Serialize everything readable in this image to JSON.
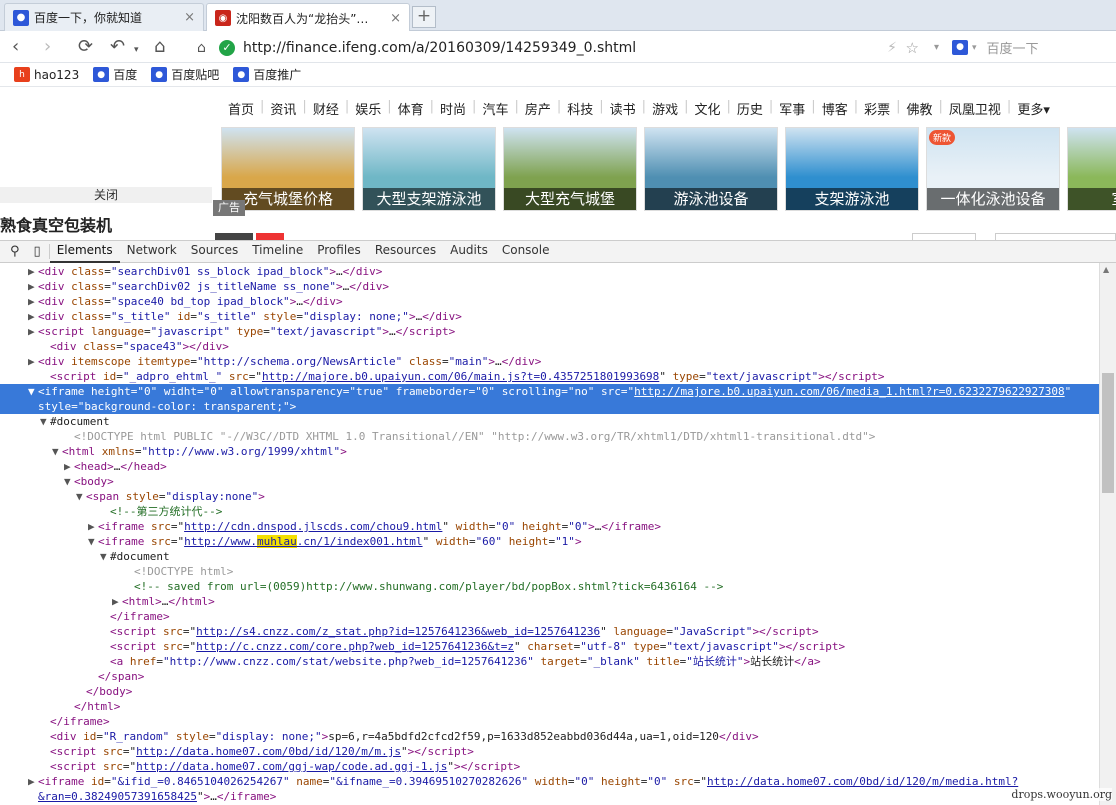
{
  "tabs": [
    {
      "title": "百度一下，你就知道",
      "close": "×",
      "color": "#2e58d8",
      "icon": "baidu-paw-icon"
    },
    {
      "title": "沈阳数百人为“龙抬头”…",
      "close": "×",
      "color": "#c9261b",
      "icon": "ifeng-icon"
    }
  ],
  "new_tab": "+",
  "address": {
    "url": "http://finance.ifeng.com/a/20160309/14259349_0.shtml"
  },
  "search": {
    "placeholder": "百度一下"
  },
  "bookmarks": [
    {
      "label": "hao123",
      "color": "#e8401c",
      "icon": "hao123-icon"
    },
    {
      "label": "百度",
      "color": "#2e58d8",
      "icon": "baidu-paw-icon"
    },
    {
      "label": "百度贴吧",
      "color": "#2e58d8",
      "icon": "baidu-paw-icon"
    },
    {
      "label": "百度推广",
      "color": "#2e58d8",
      "icon": "baidu-paw-icon"
    }
  ],
  "site_nav": [
    "首页",
    "资讯",
    "财经",
    "娱乐",
    "体育",
    "时尚",
    "汽车",
    "房产",
    "科技",
    "读书",
    "游戏",
    "文化",
    "历史",
    "军事",
    "博客",
    "彩票",
    "佛教",
    "凤凰卫视",
    "更多▾"
  ],
  "ad_thumbs": [
    {
      "caption": "充气城堡价格",
      "bg": "#d9a74a"
    },
    {
      "caption": "大型支架游泳池",
      "bg": "#6fb7c6"
    },
    {
      "caption": "大型充气城堡",
      "bg": "#7fa24f"
    },
    {
      "caption": "游泳池设备",
      "bg": "#4f8fb2"
    },
    {
      "caption": "支架游泳池",
      "bg": "#2f8fcf"
    },
    {
      "caption": "一体化泳池设备",
      "bg": "#e9f1f7"
    },
    {
      "caption": "室内游",
      "bg": "#8bb85a"
    }
  ],
  "new_badge": "新款",
  "ad_label": "广告",
  "close_label": "关闭",
  "promo_text": "熟食真空包装机",
  "devtools": {
    "tabs": [
      "Elements",
      "Network",
      "Sources",
      "Timeline",
      "Profiles",
      "Resources",
      "Audits",
      "Console"
    ],
    "active": "Elements"
  },
  "lines": [
    {
      "i": 2,
      "t": "▶",
      "h": "<span class=\"tg\">&lt;div</span> <span class=\"an\">class</span>=<span class=\"av\">\"searchDiv01 ss_block ipad_block\"</span><span class=\"tg\">&gt;</span>…<span class=\"tg\">&lt;/div&gt;</span>"
    },
    {
      "i": 2,
      "t": "▶",
      "h": "<span class=\"tg\">&lt;div</span> <span class=\"an\">class</span>=<span class=\"av\">\"searchDiv02 js_titleName ss_none\"</span><span class=\"tg\">&gt;</span>…<span class=\"tg\">&lt;/div&gt;</span>"
    },
    {
      "i": 2,
      "t": "▶",
      "h": "<span class=\"tg\">&lt;div</span> <span class=\"an\">class</span>=<span class=\"av\">\"space40 bd_top ipad_block\"</span><span class=\"tg\">&gt;</span>…<span class=\"tg\">&lt;/div&gt;</span>"
    },
    {
      "i": 2,
      "t": "▶",
      "h": "<span class=\"tg\">&lt;div</span> <span class=\"an\">class</span>=<span class=\"av\">\"s_title\"</span> <span class=\"an\">id</span>=<span class=\"av\">\"s_title\"</span> <span class=\"an\">style</span>=<span class=\"av\">\"display: none;\"</span><span class=\"tg\">&gt;</span>…<span class=\"tg\">&lt;/div&gt;</span>"
    },
    {
      "i": 2,
      "t": "▶",
      "h": "<span class=\"tg\">&lt;script</span> <span class=\"an\">language</span>=<span class=\"av\">\"javascript\"</span> <span class=\"an\">type</span>=<span class=\"av\">\"text/javascript\"</span><span class=\"tg\">&gt;</span>…<span class=\"tg\">&lt;/script&gt;</span>"
    },
    {
      "i": 3,
      "t": "",
      "h": "<span class=\"tg\">&lt;div</span> <span class=\"an\">class</span>=<span class=\"av\">\"space43\"</span><span class=\"tg\">&gt;&lt;/div&gt;</span>"
    },
    {
      "i": 2,
      "t": "▶",
      "h": "<span class=\"tg\">&lt;div</span> <span class=\"an\">itemscope</span> <span class=\"an\">itemtype</span>=<span class=\"av\">\"http://schema.org/NewsArticle\"</span> <span class=\"an\">class</span>=<span class=\"av\">\"main\"</span><span class=\"tg\">&gt;</span>…<span class=\"tg\">&lt;/div&gt;</span>"
    },
    {
      "i": 3,
      "t": "",
      "h": "<span class=\"tg\">&lt;script</span> <span class=\"an\">id</span>=<span class=\"av\">\"_adpro_ehtml_\"</span> <span class=\"an\">src</span>=\"<span class=\"lk\">http://majore.b0.upaiyun.com/06/main.js?t=0.4357251801993698</span>\" <span class=\"an\">type</span>=<span class=\"av\">\"text/javascript\"</span><span class=\"tg\">&gt;&lt;/script&gt;</span>"
    },
    {
      "i": 2,
      "t": "▼",
      "sel": true,
      "h": "<span class=\"tg\">&lt;iframe</span> <span class=\"an\">height</span>=<span class=\"av\">\"0\"</span> <span class=\"an\">widht</span>=<span class=\"av\">\"0\"</span> <span class=\"an\">allowtransparency</span>=<span class=\"av\">\"true\"</span> <span class=\"an\">frameborder</span>=<span class=\"av\">\"0\"</span> <span class=\"an\">scrolling</span>=<span class=\"av\">\"no\"</span> <span class=\"an\">src</span>=\"<span class=\"lk\">http://majore.b0.upaiyun.com/06/media_1.html?r=0.6232279622927308</span>\""
    },
    {
      "i": 2,
      "t": "",
      "sel": true,
      "h": "<span class=\"an\">style</span>=<span class=\"av\">\"background-color: transparent;\"</span><span class=\"tg\">&gt;</span>"
    },
    {
      "i": 3,
      "t": "▼",
      "h": "<span class=\"tx\">#document</span>"
    },
    {
      "i": 5,
      "t": "",
      "h": "<span class=\"dc\">&lt;!DOCTYPE html PUBLIC \"-//W3C//DTD XHTML 1.0 Transitional//EN\" \"http://www.w3.org/TR/xhtml1/DTD/xhtml1-transitional.dtd\"&gt;</span>"
    },
    {
      "i": 4,
      "t": "▼",
      "h": "<span class=\"tg\">&lt;html</span> <span class=\"an\">xmlns</span>=<span class=\"av\">\"http://www.w3.org/1999/xhtml\"</span><span class=\"tg\">&gt;</span>"
    },
    {
      "i": 5,
      "t": "▶",
      "h": "<span class=\"tg\">&lt;head&gt;</span>…<span class=\"tg\">&lt;/head&gt;</span>"
    },
    {
      "i": 5,
      "t": "▼",
      "h": "<span class=\"tg\">&lt;body&gt;</span>"
    },
    {
      "i": 6,
      "t": "▼",
      "h": "<span class=\"tg\">&lt;span</span> <span class=\"an\">style</span>=<span class=\"av\">\"display:none\"</span><span class=\"tg\">&gt;</span>"
    },
    {
      "i": 8,
      "t": "",
      "h": "<span class=\"cm\">&lt;!--第三方统计代--&gt;</span>"
    },
    {
      "i": 7,
      "t": "▶",
      "h": "<span class=\"tg\">&lt;iframe</span> <span class=\"an\">src</span>=\"<span class=\"lk\">http://cdn.dnspod.jlscds.com/chou9.html</span>\" <span class=\"an\">width</span>=<span class=\"av\">\"0\"</span> <span class=\"an\">height</span>=<span class=\"av\">\"0\"</span><span class=\"tg\">&gt;</span>…<span class=\"tg\">&lt;/iframe&gt;</span>"
    },
    {
      "i": 7,
      "t": "▼",
      "h": "<span class=\"tg\">&lt;iframe</span> <span class=\"an\">src</span>=\"<span class=\"lk\">http://www.<span class=\"hl\">muhlau</span>.cn/1/index001.html</span>\" <span class=\"an\">width</span>=<span class=\"av\">\"60\"</span> <span class=\"an\">height</span>=<span class=\"av\">\"1\"</span><span class=\"tg\">&gt;</span>"
    },
    {
      "i": 8,
      "t": "▼",
      "h": "<span class=\"tx\">#document</span>"
    },
    {
      "i": 10,
      "t": "",
      "h": "<span class=\"dc\">&lt;!DOCTYPE html&gt;</span>"
    },
    {
      "i": 10,
      "t": "",
      "h": "<span class=\"cm\">&lt;!-- saved from url=(0059)http://www.shunwang.com/player/bd/popBox.shtml?tick=6436164 --&gt;</span>"
    },
    {
      "i": 9,
      "t": "▶",
      "h": "<span class=\"tg\">&lt;html&gt;</span>…<span class=\"tg\">&lt;/html&gt;</span>"
    },
    {
      "i": 8,
      "t": "",
      "h": "<span class=\"tg\">&lt;/iframe&gt;</span>"
    },
    {
      "i": 8,
      "t": "",
      "h": "<span class=\"tg\">&lt;script</span> <span class=\"an\">src</span>=\"<span class=\"lk\">http://s4.cnzz.com/z_stat.php?id=1257641236&amp;web_id=1257641236</span>\" <span class=\"an\">language</span>=<span class=\"av\">\"JavaScript\"</span><span class=\"tg\">&gt;&lt;/script&gt;</span>"
    },
    {
      "i": 8,
      "t": "",
      "h": "<span class=\"tg\">&lt;script</span> <span class=\"an\">src</span>=\"<span class=\"lk\">http://c.cnzz.com/core.php?web_id=1257641236&amp;t=z</span>\" <span class=\"an\">charset</span>=<span class=\"av\">\"utf-8\"</span> <span class=\"an\">type</span>=<span class=\"av\">\"text/javascript\"</span><span class=\"tg\">&gt;&lt;/script&gt;</span>"
    },
    {
      "i": 8,
      "t": "",
      "h": "<span class=\"tg\">&lt;a</span> <span class=\"an\">href</span>=<span class=\"av\">\"http://www.cnzz.com/stat/website.php?web_id=1257641236\"</span> <span class=\"an\">target</span>=<span class=\"av\">\"_blank\"</span> <span class=\"an\">title</span>=<span class=\"av\">\"站长统计\"</span><span class=\"tg\">&gt;</span>站长统计<span class=\"tg\">&lt;/a&gt;</span>"
    },
    {
      "i": 7,
      "t": "",
      "h": "<span class=\"tg\">&lt;/span&gt;</span>"
    },
    {
      "i": 6,
      "t": "",
      "h": "<span class=\"tg\">&lt;/body&gt;</span>"
    },
    {
      "i": 5,
      "t": "",
      "h": "<span class=\"tg\">&lt;/html&gt;</span>"
    },
    {
      "i": 3,
      "t": "",
      "h": "<span class=\"tg\">&lt;/iframe&gt;</span>"
    },
    {
      "i": 3,
      "t": "",
      "h": "<span class=\"tg\">&lt;div</span> <span class=\"an\">id</span>=<span class=\"av\">\"R_random\"</span> <span class=\"an\">style</span>=<span class=\"av\">\"display: none;\"</span><span class=\"tg\">&gt;</span>sp=6,r=4a5bdfd2cfcd2f59,p=1633d852eabbd036d44a,ua=1,oid=120<span class=\"tg\">&lt;/div&gt;</span>"
    },
    {
      "i": 3,
      "t": "",
      "h": "<span class=\"tg\">&lt;script</span> <span class=\"an\">src</span>=\"<span class=\"lk\">http://data.home07.com/0bd/id/120/m/m.js</span>\"<span class=\"tg\">&gt;&lt;/script&gt;</span>"
    },
    {
      "i": 3,
      "t": "",
      "h": "<span class=\"tg\">&lt;script</span> <span class=\"an\">src</span>=\"<span class=\"lk\">http://data.home07.com/ggj-wap/code.ad.ggj-1.js</span>\"<span class=\"tg\">&gt;&lt;/script&gt;</span>"
    },
    {
      "i": 2,
      "t": "▶",
      "h": "<span class=\"tg\">&lt;iframe</span> <span class=\"an\">id</span>=<span class=\"av\">\"&amp;ifid_=0.8465104026254267\"</span> <span class=\"an\">name</span>=<span class=\"av\">\"&amp;ifname_=0.39469510270282626\"</span> <span class=\"an\">width</span>=<span class=\"av\">\"0\"</span> <span class=\"an\">height</span>=<span class=\"av\">\"0\"</span> <span class=\"an\">src</span>=\"<span class=\"lk\">http://data.home07.com/0bd/id/120/m/media.html?</span>"
    },
    {
      "i": 2,
      "t": "",
      "h": "<span class=\"lk\">&amp;ran=0.38249057391658425</span>\"<span class=\"tg\">&gt;</span>…<span class=\"tg\">&lt;/iframe&gt;</span>"
    }
  ],
  "watermark": "drops.wooyun.org"
}
